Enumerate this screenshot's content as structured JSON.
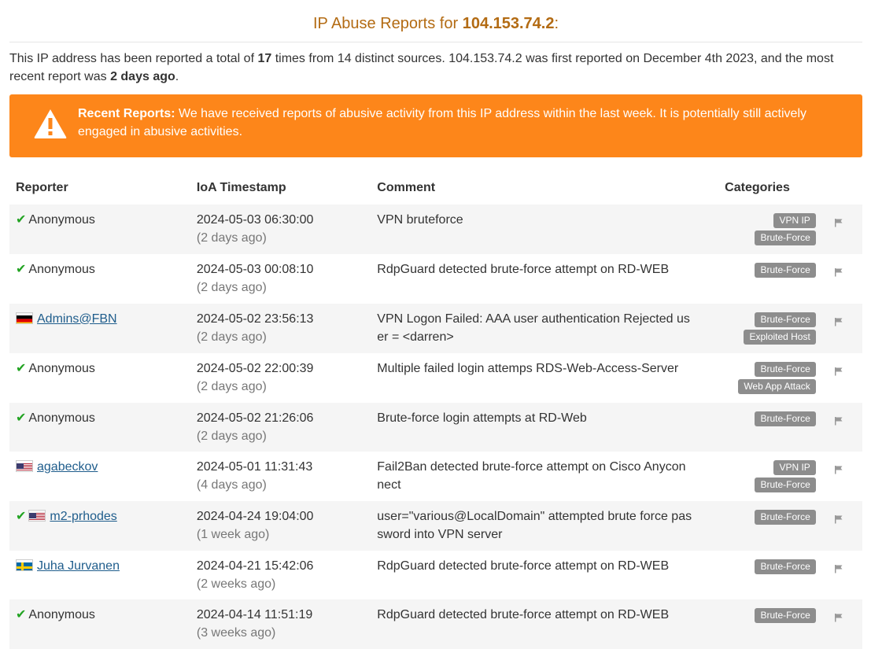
{
  "header": {
    "title_prefix": "IP Abuse Reports for ",
    "ip": "104.153.74.2",
    "title_suffix": ":"
  },
  "intro": {
    "part1": "This IP address has been reported a total of ",
    "count": "17",
    "part2": " times from 14 distinct sources. 104.153.74.2 was first reported on December 4th 2023, and the most recent report was ",
    "last": "2 days ago",
    "part3": "."
  },
  "alert": {
    "label": "Recent Reports:",
    "text": " We have received reports of abusive activity from this IP address within the last week. It is potentially still actively engaged in abusive activities."
  },
  "table": {
    "headers": {
      "reporter": "Reporter",
      "timestamp": "IoA Timestamp",
      "comment": "Comment",
      "categories": "Categories"
    },
    "rows": [
      {
        "verified": true,
        "country": "",
        "reporter": "Anonymous",
        "linked": false,
        "timestamp": "2024-05-03 06:30:00",
        "ago": "(2 days ago)",
        "comment": "VPN bruteforce",
        "categories": [
          "VPN IP",
          "Brute-Force"
        ]
      },
      {
        "verified": true,
        "country": "",
        "reporter": "Anonymous",
        "linked": false,
        "timestamp": "2024-05-03 00:08:10",
        "ago": "(2 days ago)",
        "comment": "RdpGuard detected brute-force attempt on RD-WEB",
        "categories": [
          "Brute-Force"
        ]
      },
      {
        "verified": false,
        "country": "de",
        "reporter": "Admins@FBN",
        "linked": true,
        "timestamp": "2024-05-02 23:56:13",
        "ago": "(2 days ago)",
        "comment": "VPN Logon Failed: AAA user authentication Rejected user = <darren>",
        "categories": [
          "Brute-Force",
          "Exploited Host"
        ]
      },
      {
        "verified": true,
        "country": "",
        "reporter": "Anonymous",
        "linked": false,
        "timestamp": "2024-05-02 22:00:39",
        "ago": "(2 days ago)",
        "comment": "Multiple failed login attemps RDS-Web-Access-Server",
        "categories": [
          "Brute-Force",
          "Web App Attack"
        ]
      },
      {
        "verified": true,
        "country": "",
        "reporter": "Anonymous",
        "linked": false,
        "timestamp": "2024-05-02 21:26:06",
        "ago": "(2 days ago)",
        "comment": "Brute-force login attempts at RD-Web",
        "categories": [
          "Brute-Force"
        ]
      },
      {
        "verified": false,
        "country": "us",
        "reporter": "agabeckov",
        "linked": true,
        "timestamp": "2024-05-01 11:31:43",
        "ago": "(4 days ago)",
        "comment": "Fail2Ban detected brute-force attempt on Cisco Anyconnect",
        "categories": [
          "VPN IP",
          "Brute-Force"
        ]
      },
      {
        "verified": true,
        "country": "us",
        "reporter": "m2-prhodes",
        "linked": true,
        "timestamp": "2024-04-24 19:04:00",
        "ago": "(1 week ago)",
        "comment": "user=\"various@LocalDomain\" attempted brute force password into VPN server",
        "categories": [
          "Brute-Force"
        ]
      },
      {
        "verified": false,
        "country": "se",
        "reporter": "Juha Jurvanen",
        "linked": true,
        "timestamp": "2024-04-21 15:42:06",
        "ago": "(2 weeks ago)",
        "comment": "RdpGuard detected brute-force attempt on RD-WEB",
        "categories": [
          "Brute-Force"
        ]
      },
      {
        "verified": true,
        "country": "",
        "reporter": "Anonymous",
        "linked": false,
        "timestamp": "2024-04-14 11:51:19",
        "ago": "(3 weeks ago)",
        "comment": "RdpGuard detected brute-force attempt on RD-WEB",
        "categories": [
          "Brute-Force"
        ]
      }
    ]
  },
  "colors": {
    "title": "#b36b13",
    "alert_bg": "#fd861a",
    "badge": "#8d8d8d",
    "check": "#22a322",
    "link": "#1f5d8c"
  },
  "icons": {
    "alert": "warning-triangle-icon",
    "verified": "checkmark-icon",
    "report": "flag-icon"
  }
}
